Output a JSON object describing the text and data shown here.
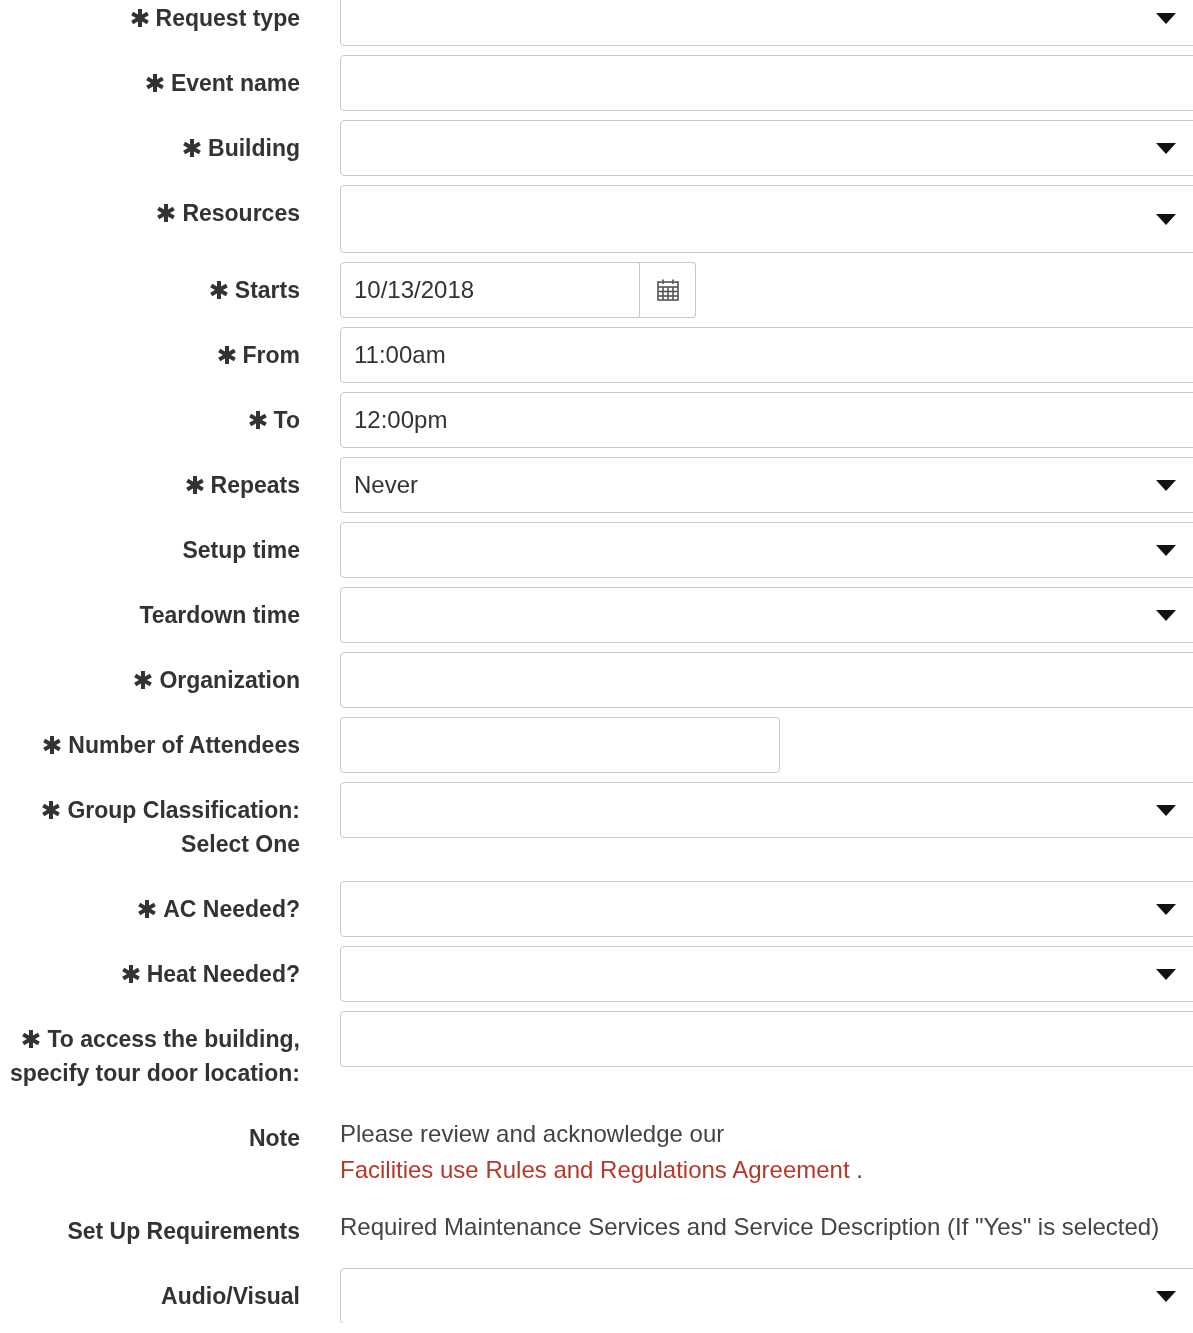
{
  "form": {
    "rows": [
      {
        "kind": "select",
        "label": "Request type",
        "required": true
      },
      {
        "kind": "text",
        "label": "Event name",
        "required": true
      },
      {
        "kind": "select",
        "label": "Building",
        "required": true
      },
      {
        "kind": "multiselect",
        "label": "Resources",
        "required": true
      },
      {
        "kind": "date",
        "label": "Starts",
        "required": true,
        "value": "10/13/2018"
      },
      {
        "kind": "text",
        "label": "From",
        "required": true,
        "value": "11:00am"
      },
      {
        "kind": "text",
        "label": "To",
        "required": true,
        "value": "12:00pm"
      },
      {
        "kind": "select",
        "label": "Repeats",
        "required": true,
        "value": "Never"
      },
      {
        "kind": "select",
        "label": "Setup time",
        "required": false
      },
      {
        "kind": "select",
        "label": "Teardown time",
        "required": false
      },
      {
        "kind": "text",
        "label": "Organization",
        "required": true
      },
      {
        "kind": "short",
        "label": "Number of Attendees",
        "required": true
      },
      {
        "kind": "select",
        "label": "Group Classification: Select One",
        "required": true
      },
      {
        "kind": "select",
        "label": "AC Needed?",
        "required": true
      },
      {
        "kind": "select",
        "label": "Heat Needed?",
        "required": true
      },
      {
        "kind": "text",
        "label": "To access the building, specify tour door location:",
        "required": true
      },
      {
        "kind": "note",
        "label": "Note",
        "required": false,
        "text_before": "Please review and acknowledge our",
        "link": "Facilities use Rules and Regulations Agreement",
        "text_after": "."
      },
      {
        "kind": "info",
        "label": "Set Up Requirements",
        "required": false,
        "text": "Required Maintenance Services and Service Description (If \"Yes\" is selected)"
      },
      {
        "kind": "select",
        "label": "Audio/Visual",
        "required": false
      }
    ]
  }
}
